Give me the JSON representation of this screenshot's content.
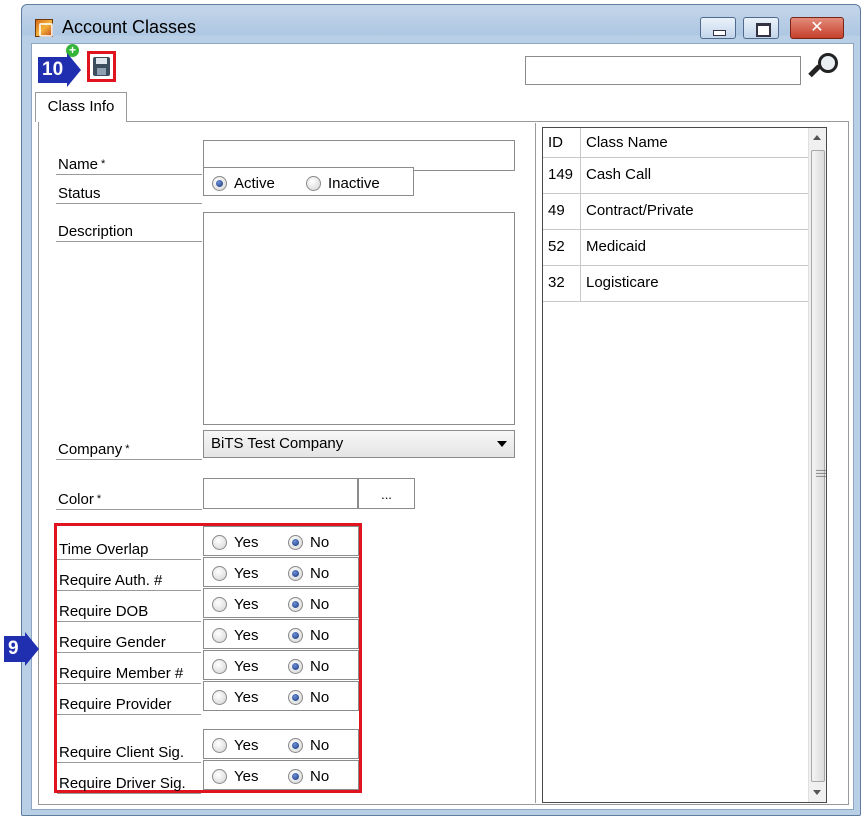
{
  "window": {
    "title": "Account Classes",
    "close_glyph": "✕",
    "icons": [
      "app-icon",
      "minimize-icon",
      "maximize-icon",
      "close-icon",
      "save-icon",
      "add-icon",
      "search-icon"
    ]
  },
  "callouts": {
    "save": "10",
    "requirements": "9"
  },
  "search": {
    "value": "",
    "placeholder": ""
  },
  "tabs": [
    {
      "label": "Class Info",
      "active": true
    }
  ],
  "form": {
    "name": {
      "label": "Name",
      "required_mark": "*",
      "value": ""
    },
    "status": {
      "label": "Status",
      "options": [
        "Active",
        "Inactive"
      ],
      "selected": "Active"
    },
    "description": {
      "label": "Description",
      "value": ""
    },
    "company": {
      "label": "Company",
      "required_mark": "*",
      "value": "BiTS Test Company"
    },
    "color": {
      "label": "Color",
      "required_mark": "*",
      "value": "",
      "button_label": "..."
    }
  },
  "requirements": {
    "yes_label": "Yes",
    "no_label": "No",
    "items": [
      {
        "label": "Time Overlap",
        "selected": "No"
      },
      {
        "label": "Require Auth. #",
        "selected": "No"
      },
      {
        "label": "Require DOB",
        "selected": "No"
      },
      {
        "label": "Require Gender",
        "selected": "No"
      },
      {
        "label": "Require Member #",
        "selected": "No"
      },
      {
        "label": "Require Provider",
        "selected": "No"
      },
      {
        "label": "Require Client Sig.",
        "selected": "No"
      },
      {
        "label": "Require Driver Sig.",
        "selected": "No"
      }
    ]
  },
  "class_list": {
    "columns": [
      "ID",
      "Class Name"
    ],
    "rows": [
      {
        "id": "149",
        "name": "Cash Call"
      },
      {
        "id": "49",
        "name": "Contract/Private"
      },
      {
        "id": "52",
        "name": "Medicaid"
      },
      {
        "id": "32",
        "name": "Logisticare"
      }
    ]
  },
  "colors": {
    "highlight_border": "#e0141e",
    "callout_bg": "#1f2fb0",
    "title_gradient": "#aec7e2"
  }
}
